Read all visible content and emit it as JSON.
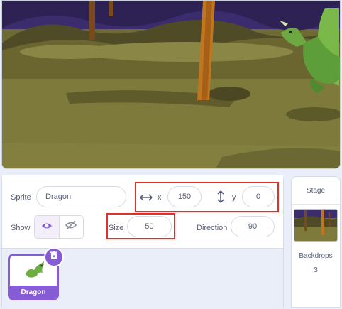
{
  "sprite_info": {
    "sprite_label": "Sprite",
    "sprite_name": "Dragon",
    "x_label": "x",
    "x_value": "150",
    "y_label": "y",
    "y_value": "0",
    "show_label": "Show",
    "size_label": "Size",
    "size_value": "50",
    "direction_label": "Direction",
    "direction_value": "90"
  },
  "sprite_list": {
    "items": [
      {
        "name": "Dragon"
      }
    ]
  },
  "stage_panel": {
    "title": "Stage",
    "backdrops_label": "Backdrops",
    "backdrops_count": "3"
  },
  "colors": {
    "accent": "#855cd6",
    "highlight": "#e0302c",
    "text": "#575e75"
  },
  "icons": [
    "x-arrows-icon",
    "y-arrows-icon",
    "eye-icon",
    "eye-off-icon",
    "dragon-icon",
    "trash-icon"
  ]
}
